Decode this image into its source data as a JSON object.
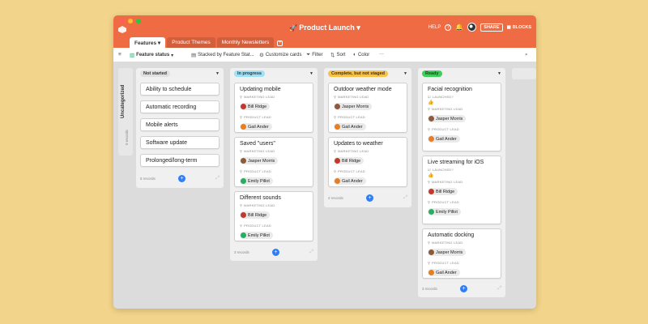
{
  "app": {
    "base_name": "Product Launch",
    "base_icon": "rocket-icon",
    "help_label": "HELP",
    "share_label": "SHARE",
    "blocks_label": "BLOCKS"
  },
  "tabs": [
    {
      "label": "Features",
      "active": true
    },
    {
      "label": "Product Themes",
      "active": false
    },
    {
      "label": "Monthly Newsletters",
      "active": false
    }
  ],
  "toolbar": {
    "view_name": "Feature status",
    "stacked_by": "Stacked by Feature Stat...",
    "customize": "Customize cards",
    "filter": "Filter",
    "sort": "Sort",
    "color": "Color",
    "more": "···"
  },
  "uncategorized": {
    "label": "Uncategorized",
    "count": "0 records"
  },
  "field_labels": {
    "marketing": "MARKETING LEAD",
    "product": "PRODUCT LEAD",
    "launched": "LAUNCHED?"
  },
  "columns": [
    {
      "status": "Not started",
      "color": "#e0e0e0",
      "records": "5 records",
      "cards": [
        "Ability to schedule",
        "Automatic recording",
        "Mobile alerts",
        "Software update",
        "Prolonged/long-term"
      ]
    },
    {
      "status": "In progress",
      "color": "#9fe0f5",
      "records": "3 records",
      "cards": [
        {
          "title": "Updating mobile",
          "marketing": "Bill Ridge",
          "product": "Gail Ander"
        },
        {
          "title": "Saved \"users\"",
          "marketing": "Jasper Morris",
          "product": "Emily Pillot"
        },
        {
          "title": "Different sounds",
          "marketing": "Bill Ridge",
          "product": "Emily Pillot"
        }
      ]
    },
    {
      "status": "Complete, but not staged",
      "color": "#f8c24a",
      "records": "2 records",
      "cards": [
        {
          "title": "Outdoor weather mode",
          "marketing": "Jasper Morris",
          "product": "Gail Ander"
        },
        {
          "title": "Updates to weather",
          "marketing": "Bill Ridge",
          "product": "Gail Ander"
        }
      ]
    },
    {
      "status": "Ready",
      "color": "#3ecf5a",
      "records": "3 records",
      "cards": [
        {
          "title": "Facial recognition",
          "marketing": "Jasper Morris",
          "product": "Gail Ander",
          "launched": true
        },
        {
          "title": "Live streaming for iOS",
          "marketing": "Bill Ridge",
          "product": "Emily Pillot",
          "launched": true
        },
        {
          "title": "Automatic docking",
          "marketing": "Jasper Morris",
          "product": "Gail Ander",
          "launched": false
        }
      ]
    }
  ],
  "colors": {
    "accent": "#ef6b44",
    "add_button": "#2d7ff9",
    "launched_thumb": "#20a86b"
  }
}
